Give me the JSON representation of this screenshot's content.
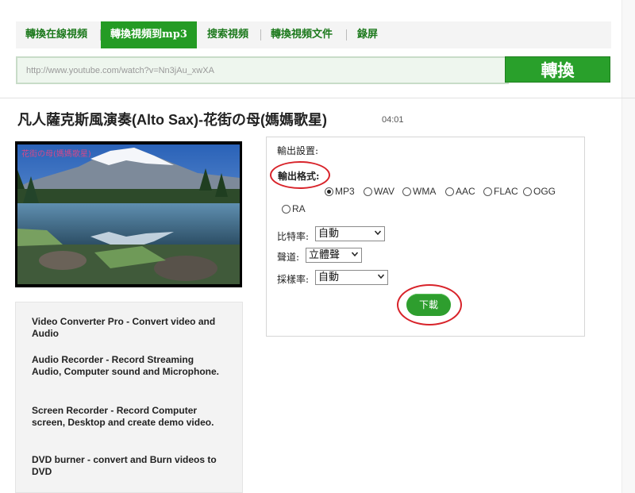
{
  "nav": {
    "tabs": [
      {
        "label": "轉換在線視頻"
      },
      {
        "label": "轉換視頻到mp3",
        "active": true
      },
      {
        "label": "搜索視頻"
      },
      {
        "label": "轉換視頻文件"
      },
      {
        "label": "錄屏"
      }
    ]
  },
  "url_bar": {
    "value": "http://www.youtube.com/watch?v=Nn3jAu_xwXA"
  },
  "convert_button": {
    "label": "轉換"
  },
  "video": {
    "title": "凡人薩克斯風演奏(Alto Sax)-花街の母(媽媽歌星)",
    "duration": "04:01",
    "thumbnail_caption": "花街の母(媽媽歌星)"
  },
  "settings": {
    "heading": "輸出設置:",
    "format_label": "輸出格式:",
    "formats": [
      "MP3",
      "WAV",
      "WMA",
      "AAC",
      "FLAC",
      "OGG",
      "RA"
    ],
    "selected_format": "MP3",
    "bitrate_label": "比特率:",
    "bitrate_value": "自動",
    "channel_label": "聲道:",
    "channel_value": "立體聲",
    "samplerate_label": "採樣率:",
    "samplerate_value": "自動",
    "download_label": "下載"
  },
  "products": [
    {
      "text": "Video Converter Pro - Convert video and Audio"
    },
    {
      "text": "Audio Recorder - Record Streaming Audio, Computer sound and Microphone."
    },
    {
      "text": "Screen Recorder - Record Computer screen, Desktop and create demo video."
    },
    {
      "text": "DVD burner - convert and Burn videos to DVD"
    }
  ],
  "colors": {
    "brand_green": "#249b24",
    "highlight_red": "#d8232a"
  }
}
